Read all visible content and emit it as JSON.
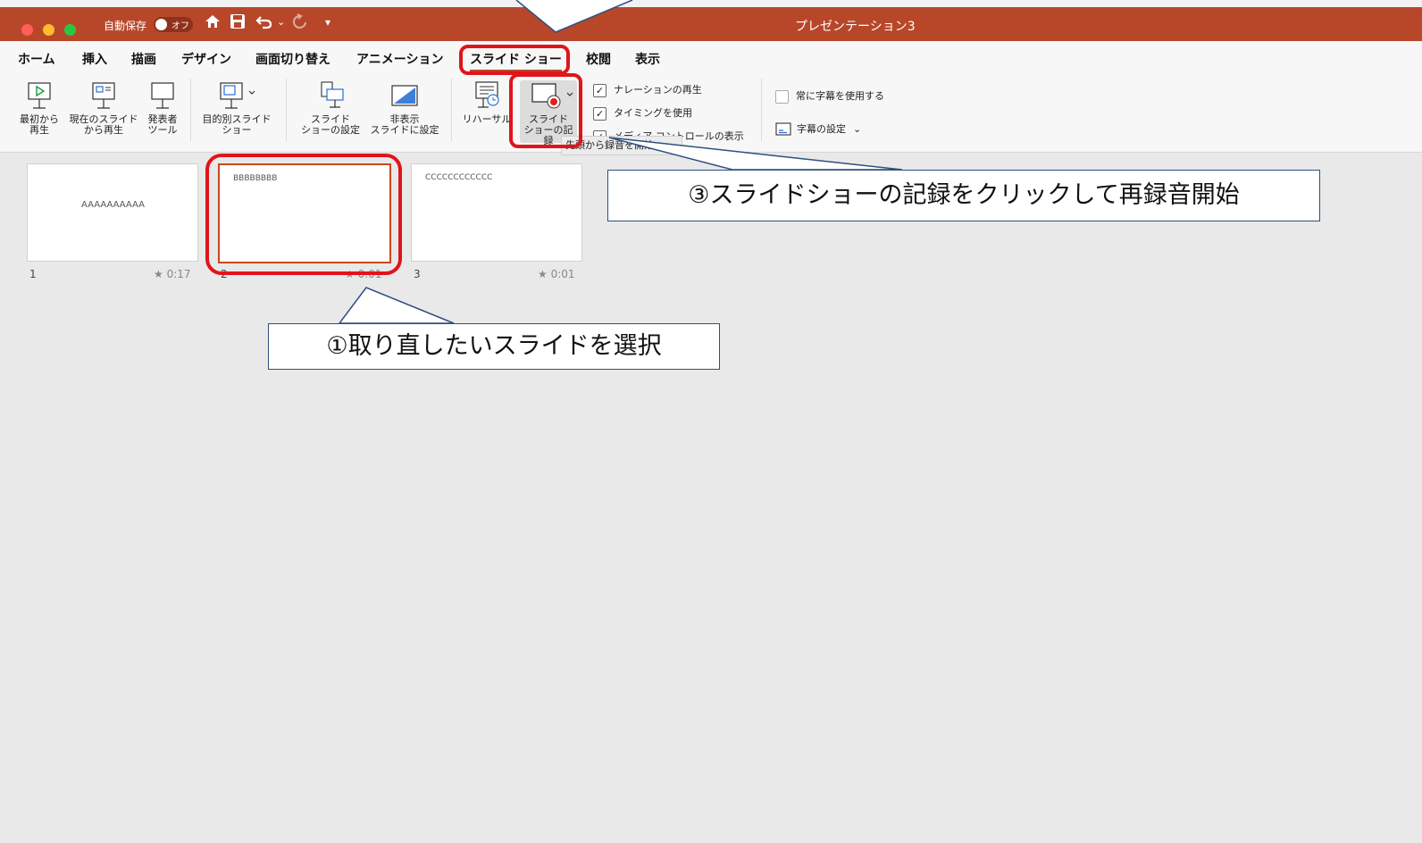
{
  "titlebar": {
    "autosave_label": "自動保存",
    "autosave_state": "オフ",
    "window_title": "プレゼンテーション3",
    "icons": [
      "home-icon",
      "save-icon",
      "undo-icon",
      "redo-icon",
      "customize-icon"
    ]
  },
  "menu": {
    "tabs": [
      {
        "label": "ホーム"
      },
      {
        "label": "挿入"
      },
      {
        "label": "描画"
      },
      {
        "label": "デザイン"
      },
      {
        "label": "画面切り替え"
      },
      {
        "label": "アニメーション"
      },
      {
        "label": "スライド ショー",
        "selected": true
      },
      {
        "label": "校閲"
      },
      {
        "label": "表示"
      }
    ]
  },
  "ribbon": {
    "from_start": {
      "line1": "最初から",
      "line2": "再生"
    },
    "from_current": {
      "line1": "現在のスライド",
      "line2": "から再生"
    },
    "presenter_tools": {
      "line1": "発表者",
      "line2": "ツール"
    },
    "custom_show": {
      "line1": "目的別スライド",
      "line2": "ショー"
    },
    "setup_show": {
      "line1": "スライド",
      "line2": "ショーの設定"
    },
    "hide_slide": {
      "line1": "非表示",
      "line2": "スライドに設定"
    },
    "rehearse": {
      "line1": "リハーサル"
    },
    "record_show": {
      "line1": "スライド",
      "line2": "ショーの記録"
    },
    "play_narrations": {
      "label": "ナレーションの再生",
      "checked": true
    },
    "use_timings": {
      "label": "タイミングを使用",
      "checked": true
    },
    "media_controls": {
      "label": "メディア コントロールの表示",
      "checked": true
    },
    "always_subtitles": {
      "label": "常に字幕を使用する",
      "checked": false
    },
    "subtitle_settings": {
      "label": "字幕の設定"
    },
    "tooltip": "先頭から録音を開始"
  },
  "slides": [
    {
      "number": "1",
      "text": "AAAAAAAAAA",
      "time": "0:17"
    },
    {
      "number": "2",
      "text": "BBBBBBBB",
      "time": "0:01"
    },
    {
      "number": "3",
      "text": "CCCCCCCCCCCC",
      "time": "0:01"
    }
  ],
  "callouts": {
    "step1": "①取り直したいスライドを選択",
    "step3": "③スライドショーの記録をクリックして再録音開始"
  },
  "colors": {
    "titlebar": "#b8472a",
    "highlight_red": "#e0141a",
    "callout_border": "#2f4f7f"
  }
}
